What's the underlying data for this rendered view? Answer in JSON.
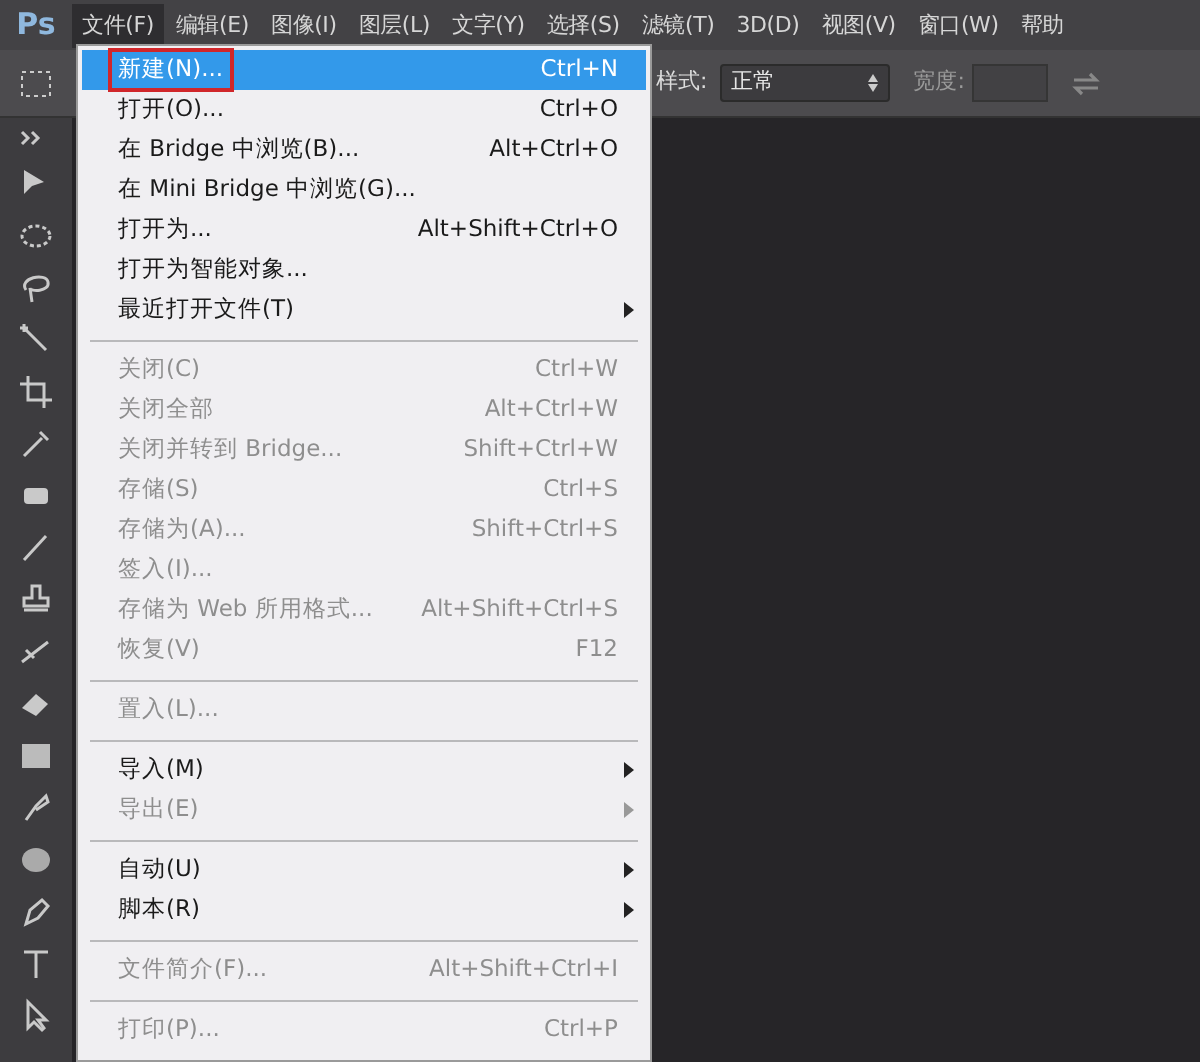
{
  "app_logo": "Ps",
  "menu_bar": [
    {
      "label": "文件(F)",
      "selected": true
    },
    {
      "label": "编辑(E)",
      "selected": false
    },
    {
      "label": "图像(I)",
      "selected": false
    },
    {
      "label": "图层(L)",
      "selected": false
    },
    {
      "label": "文字(Y)",
      "selected": false
    },
    {
      "label": "选择(S)",
      "selected": false
    },
    {
      "label": "滤镜(T)",
      "selected": false
    },
    {
      "label": "3D(D)",
      "selected": false
    },
    {
      "label": "视图(V)",
      "selected": false
    },
    {
      "label": "窗口(W)",
      "selected": false
    },
    {
      "label": "帮助",
      "selected": false
    }
  ],
  "options_bar": {
    "style_label": "样式:",
    "style_value": "正常",
    "width_label": "宽度:"
  },
  "file_menu": [
    [
      {
        "label": "新建(N)...",
        "shortcut": "Ctrl+N",
        "selected": true,
        "outlined": true,
        "disabled": false,
        "submenu": false
      },
      {
        "label": "打开(O)...",
        "shortcut": "Ctrl+O",
        "selected": false,
        "outlined": false,
        "disabled": false,
        "submenu": false
      },
      {
        "label": "在 Bridge 中浏览(B)...",
        "shortcut": "Alt+Ctrl+O",
        "selected": false,
        "outlined": false,
        "disabled": false,
        "submenu": false
      },
      {
        "label": "在 Mini Bridge 中浏览(G)...",
        "selected": false,
        "outlined": false,
        "disabled": false,
        "submenu": false
      },
      {
        "label": "打开为...",
        "shortcut": "Alt+Shift+Ctrl+O",
        "selected": false,
        "outlined": false,
        "disabled": false,
        "submenu": false
      },
      {
        "label": "打开为智能对象...",
        "selected": false,
        "outlined": false,
        "disabled": false,
        "submenu": false
      },
      {
        "label": "最近打开文件(T)",
        "selected": false,
        "outlined": false,
        "disabled": false,
        "submenu": true
      }
    ],
    [
      {
        "label": "关闭(C)",
        "shortcut": "Ctrl+W",
        "selected": false,
        "outlined": false,
        "disabled": true,
        "submenu": false
      },
      {
        "label": "关闭全部",
        "shortcut": "Alt+Ctrl+W",
        "selected": false,
        "outlined": false,
        "disabled": true,
        "submenu": false
      },
      {
        "label": "关闭并转到 Bridge...",
        "shortcut": "Shift+Ctrl+W",
        "selected": false,
        "outlined": false,
        "disabled": true,
        "submenu": false
      },
      {
        "label": "存储(S)",
        "shortcut": "Ctrl+S",
        "selected": false,
        "outlined": false,
        "disabled": true,
        "submenu": false
      },
      {
        "label": "存储为(A)...",
        "shortcut": "Shift+Ctrl+S",
        "selected": false,
        "outlined": false,
        "disabled": true,
        "submenu": false
      },
      {
        "label": "签入(I)...",
        "selected": false,
        "outlined": false,
        "disabled": true,
        "submenu": false
      },
      {
        "label": "存储为 Web 所用格式...",
        "shortcut": "Alt+Shift+Ctrl+S",
        "selected": false,
        "outlined": false,
        "disabled": true,
        "submenu": false
      },
      {
        "label": "恢复(V)",
        "shortcut": "F12",
        "selected": false,
        "outlined": false,
        "disabled": true,
        "submenu": false
      }
    ],
    [
      {
        "label": "置入(L)...",
        "selected": false,
        "outlined": false,
        "disabled": true,
        "submenu": false
      }
    ],
    [
      {
        "label": "导入(M)",
        "selected": false,
        "outlined": false,
        "disabled": false,
        "submenu": true
      },
      {
        "label": "导出(E)",
        "selected": false,
        "outlined": false,
        "disabled": true,
        "submenu": true
      }
    ],
    [
      {
        "label": "自动(U)",
        "selected": false,
        "outlined": false,
        "disabled": false,
        "submenu": true
      },
      {
        "label": "脚本(R)",
        "selected": false,
        "outlined": false,
        "disabled": false,
        "submenu": true
      }
    ],
    [
      {
        "label": "文件简介(F)...",
        "shortcut": "Alt+Shift+Ctrl+I",
        "selected": false,
        "outlined": false,
        "disabled": true,
        "submenu": false
      }
    ],
    [
      {
        "label": "打印(P)...",
        "shortcut": "Ctrl+P",
        "selected": false,
        "outlined": false,
        "disabled": true,
        "submenu": false
      }
    ]
  ]
}
